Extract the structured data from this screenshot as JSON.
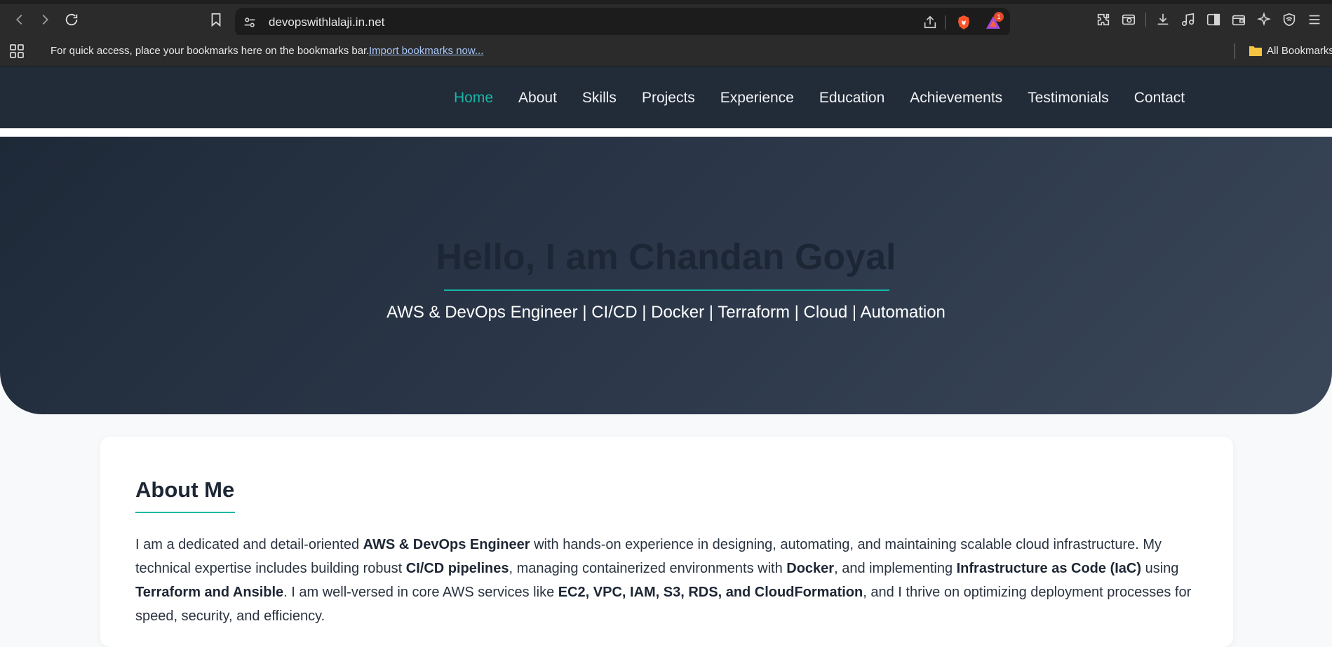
{
  "browser": {
    "url": "devopswithlalaji.in.net",
    "rewards_badge": "1",
    "bookmarks_bar": {
      "message": "For quick access, place your bookmarks here on the bookmarks bar.",
      "import_link": "Import bookmarks now...",
      "all_bookmarks": "All Bookmarks"
    },
    "icons": [
      "back-icon",
      "forward-icon",
      "reload-icon",
      "bookmark-icon",
      "site-settings-icon",
      "share-icon",
      "brave-shields-icon",
      "brave-rewards-icon",
      "extensions-icon",
      "screenshot-icon",
      "downloads-icon",
      "media-icon",
      "sidebar-icon",
      "wallet-icon",
      "leo-ai-icon",
      "vpn-icon",
      "menu-icon",
      "apps-icon",
      "folder-icon"
    ]
  },
  "nav": {
    "items": [
      {
        "label": "Home",
        "active": true
      },
      {
        "label": "About"
      },
      {
        "label": "Skills"
      },
      {
        "label": "Projects"
      },
      {
        "label": "Experience"
      },
      {
        "label": "Education"
      },
      {
        "label": "Achievements"
      },
      {
        "label": "Testimonials"
      },
      {
        "label": "Contact"
      }
    ]
  },
  "hero": {
    "title": "Hello, I am Chandan Goyal",
    "subtitle": "AWS & DevOps Engineer | CI/CD | Docker | Terraform | Cloud | Automation"
  },
  "about": {
    "title": "About Me",
    "segments": [
      {
        "text": "I am a dedicated and detail-oriented ",
        "bold": false
      },
      {
        "text": "AWS & DevOps Engineer",
        "bold": true
      },
      {
        "text": " with hands-on experience in designing, automating, and maintaining scalable cloud infrastructure. My technical expertise includes building robust ",
        "bold": false
      },
      {
        "text": "CI/CD pipelines",
        "bold": true
      },
      {
        "text": ", managing containerized environments with ",
        "bold": false
      },
      {
        "text": "Docker",
        "bold": true
      },
      {
        "text": ", and implementing ",
        "bold": false
      },
      {
        "text": "Infrastructure as Code (IaC)",
        "bold": true
      },
      {
        "text": " using ",
        "bold": false
      },
      {
        "text": "Terraform and Ansible",
        "bold": true
      },
      {
        "text": ". I am well-versed in core AWS services like ",
        "bold": false
      },
      {
        "text": "EC2, VPC, IAM, S3, RDS, and CloudFormation",
        "bold": true
      },
      {
        "text": ", and I thrive on optimizing deployment processes for speed, security, and efficiency.",
        "bold": false
      }
    ]
  },
  "colors": {
    "accent": "#14b8a6",
    "nav_bg": "#222b38",
    "hero_bg_start": "#1e2938",
    "hero_bg_end": "#3a4759",
    "page_bg": "#f7f9fb"
  }
}
